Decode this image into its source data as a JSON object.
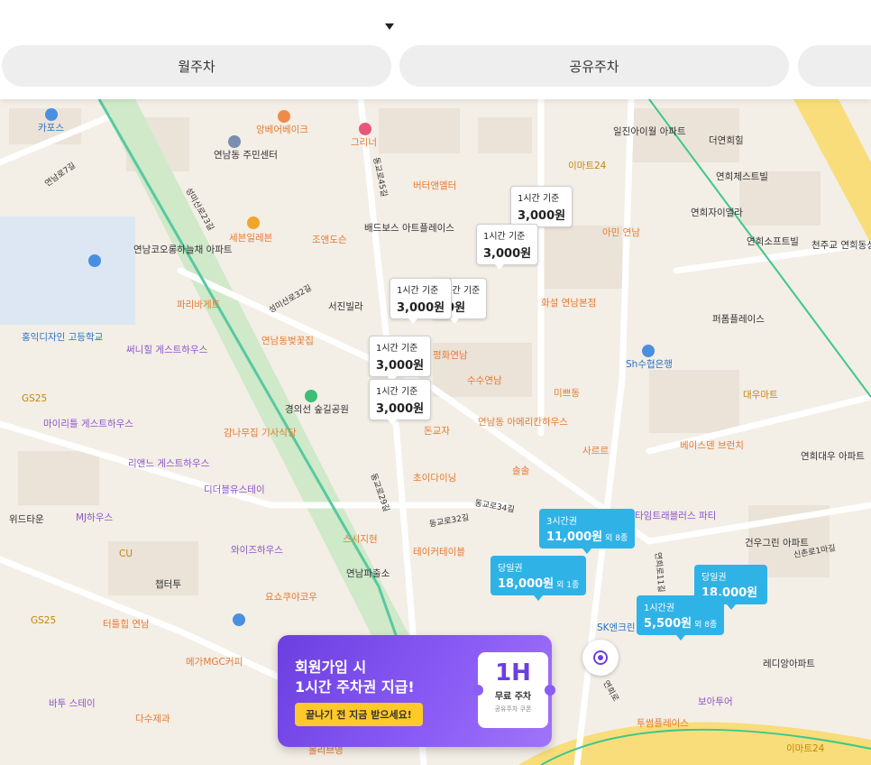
{
  "header": {
    "tabs": [
      {
        "label": "월주차"
      },
      {
        "label": "공유주차"
      },
      {
        "label": ""
      }
    ]
  },
  "price_pins": [
    {
      "label": "1시간 기준",
      "price": "3,000원"
    },
    {
      "label": "1시간 기준",
      "price": "3,000원"
    },
    {
      "label": "1시간 기준",
      "price": "3,000원"
    },
    {
      "label": "1시간 기준",
      "price": "00원"
    },
    {
      "label": "1시간 기준",
      "price": "3,000원"
    },
    {
      "label": "1시간 기준",
      "price": "3,000원"
    }
  ],
  "ticket_pins": [
    {
      "label": "3시간권",
      "price": "11,000원",
      "extra": "외 8종"
    },
    {
      "label": "당일권",
      "price": "18,000원",
      "extra": "외 1종"
    },
    {
      "label": "당일권",
      "price": "18,000원",
      "extra": ""
    },
    {
      "label": "1시간권",
      "price": "5,500원",
      "extra": "외 8종"
    }
  ],
  "places": [
    "카포스",
    "앙베어베이크",
    "그리너",
    "연남동 주민센터",
    "버터앤엘터",
    "배드보스 아트플레이스",
    "세븐일레븐",
    "조앤도슨",
    "연남코오롱하늘채 아파트",
    "파리바게트",
    "서진빌라",
    "연남동벚꽃집",
    "홍익디자인 고등학교",
    "써니힐 게스트하우스",
    "GS25",
    "경의선 숲길공원",
    "마이리틀 게스트하우스",
    "감나무집 기사식당",
    "리앤느 게스트하우스",
    "디더블유스테이",
    "위드타운",
    "MJ하우스",
    "CU",
    "와이즈하우스",
    "챕터투",
    "요쇼쿠야코우",
    "GS25",
    "터틀힙 연남",
    "메가MGC커피",
    "바투 스테이",
    "다수제과",
    "올리브영",
    "일진아이월 아파트",
    "더연희힐",
    "이마트24",
    "연희체스트빌",
    "연희자이엘라",
    "아민 연남",
    "연희소프트빌",
    "천주교 연희동성당",
    "퍼폼플레이스",
    "화설 연남본점",
    "평화연남",
    "수수연남",
    "미쁘동",
    "Sh수협은행",
    "대우마트",
    "연남동 아메리칸하우스",
    "사르르",
    "초이다이닝",
    "솔솔",
    "베이스덴 브런치",
    "연희대우 아파트",
    "타임트래블러스 파티",
    "테이커테이블",
    "스시지현",
    "연남파출소",
    "건우그린 아파트",
    "SK엔크린",
    "레디앙아파트",
    "보아투어",
    "투썸플레이스",
    "이마트24",
    "돈교자"
  ],
  "roads": [
    "연남로7길",
    "성미산로23길",
    "동교로45길",
    "성미산로32길",
    "동교로29길",
    "동교로32길",
    "동교로34길",
    "연희로11길",
    "연희로",
    "신촌로1마길"
  ],
  "banner": {
    "line1": "회원가입 시",
    "line2": "1시간 주차권 지급!",
    "cta": "끝나기 전 지금 받으세요!",
    "coupon_big": "1H",
    "coupon_title": "무료 주차",
    "coupon_sub": "공유주차 쿠폰"
  },
  "colors": {
    "ticket_pin": "#2fb3e6",
    "banner": "#7a4ae8",
    "cta": "#ffc928",
    "rail": "#3cc88b"
  }
}
